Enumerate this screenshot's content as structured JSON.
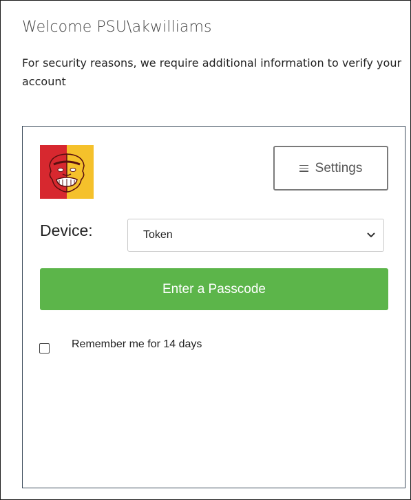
{
  "header": {
    "welcome": "Welcome PSU\\akwilliams",
    "notice": "For security reasons, we require additional information to verify your account"
  },
  "duo": {
    "logo_icon": "gorilla-mascot-logo",
    "settings_icon": "hamburger-icon",
    "settings_label": "Settings",
    "device_label": "Device:",
    "device_selected": "Token",
    "passcode_button_label": "Enter a Passcode",
    "remember_checked": false,
    "remember_label": "Remember me for 14 days",
    "colors": {
      "logo_red": "#d7282f",
      "logo_gold": "#f5c12b",
      "primary_green": "#5cb54a",
      "frame_border": "#3a4a5a"
    }
  }
}
